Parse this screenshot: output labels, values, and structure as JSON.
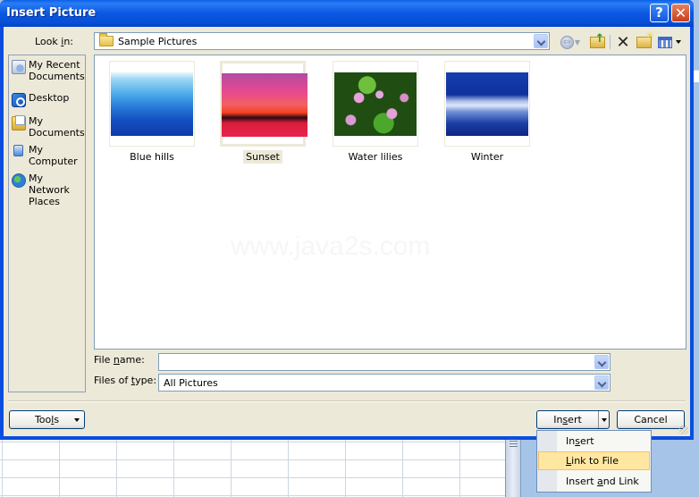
{
  "window": {
    "title": "Insert Picture",
    "help_label": "?",
    "close_label": "✕"
  },
  "look_in": {
    "label_pre": "Look ",
    "label_u": "i",
    "label_post": "n:",
    "value": "Sample Pictures",
    "icon": "folder-icon"
  },
  "toolbar": {
    "icons": [
      "back-icon",
      "dropdown-icon",
      "up-one-level-icon",
      "delete-icon",
      "new-folder-icon",
      "views-icon",
      "views-dropdown-icon"
    ]
  },
  "places": [
    {
      "label": "My Recent Documents",
      "line1": "My Recent",
      "line2": "Documents",
      "icon": "recent-documents-icon"
    },
    {
      "label": "Desktop",
      "line1": "Desktop",
      "line2": "",
      "icon": "desktop-icon"
    },
    {
      "label": "My Documents",
      "line1": "My",
      "line2": "Documents",
      "icon": "my-documents-icon"
    },
    {
      "label": "My Computer",
      "line1": "My",
      "line2": "Computer",
      "icon": "my-computer-icon"
    },
    {
      "label": "My Network Places",
      "line1": "My Network",
      "line2": "Places",
      "icon": "network-places-icon"
    }
  ],
  "files": [
    {
      "name": "Blue hills",
      "selected": false
    },
    {
      "name": "Sunset",
      "selected": true
    },
    {
      "name": "Water lilies",
      "selected": false
    },
    {
      "name": "Winter",
      "selected": false
    }
  ],
  "watermark": "www.java2s.com",
  "file_name": {
    "label_pre": "File ",
    "label_u": "n",
    "label_post": "ame:",
    "value": ""
  },
  "file_type": {
    "label_pre": "Files of ",
    "label_u": "t",
    "label_post": "ype:",
    "value": "All Pictures"
  },
  "buttons": {
    "tools_pre": "Too",
    "tools_u": "l",
    "tools_post": "s",
    "insert_pre": "In",
    "insert_u": "s",
    "insert_post": "ert",
    "cancel": "Cancel"
  },
  "insert_menu": {
    "items": [
      {
        "pre": "In",
        "u": "s",
        "post": "ert",
        "highlighted": false
      },
      {
        "pre": "",
        "u": "L",
        "post": "ink to File",
        "highlighted": true
      },
      {
        "pre": "Insert ",
        "u": "a",
        "post": "nd Link",
        "highlighted": false
      }
    ]
  }
}
